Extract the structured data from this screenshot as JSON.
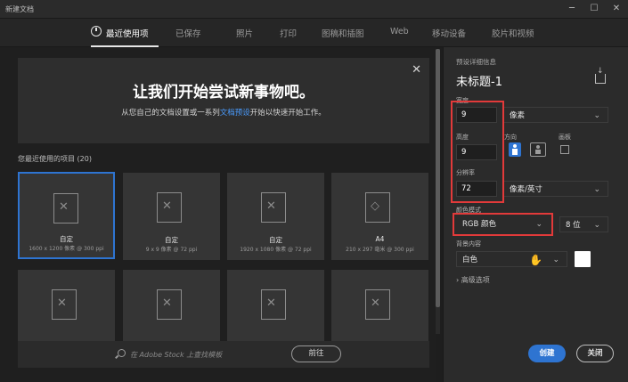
{
  "window": {
    "title": "新建文档",
    "min_icon": "─",
    "max_icon": "☐",
    "close_icon": "✕"
  },
  "tabs": [
    {
      "label": "最近使用项",
      "active": true
    },
    {
      "label": "已保存"
    },
    {
      "label": "照片"
    },
    {
      "label": "打印"
    },
    {
      "label": "图稿和插图"
    },
    {
      "label": "Web"
    },
    {
      "label": "移动设备"
    },
    {
      "label": "胶片和视频"
    }
  ],
  "welcome": {
    "headline": "让我们开始尝试新事物吧。",
    "sub_before": "从您自己的文档设置或一系列",
    "sub_link": "文档预设",
    "sub_after": "开始以快速开始工作。",
    "close_icon": "✕"
  },
  "recent": {
    "label": "您最近使用的项目",
    "count": "(20)",
    "items": [
      {
        "name": "自定",
        "meta": "1600 x 1200 像素 @ 300 ppi",
        "selected": true
      },
      {
        "name": "自定",
        "meta": "9 x 9 像素 @ 72 ppi"
      },
      {
        "name": "自定",
        "meta": "1920 x 1080 像素 @ 72 ppi"
      },
      {
        "name": "A4",
        "meta": "210 x 297 毫米 @ 300 ppi"
      }
    ]
  },
  "stock_search": {
    "placeholder": "在 Adobe Stock 上查找模板",
    "go_label": "前往"
  },
  "preset": {
    "section_label": "预设详细信息",
    "doc_title": "未标题-1",
    "width_label": "宽度",
    "width_value": "9",
    "width_unit": "像素",
    "height_label": "高度",
    "height_value": "9",
    "orientation_label": "方向",
    "artboard_label": "画板",
    "resolution_label": "分辨率",
    "resolution_value": "72",
    "resolution_unit": "像素/英寸",
    "color_mode_label": "颜色模式",
    "color_mode_value": "RGB 颜色",
    "bit_depth_value": "8 位",
    "background_label": "背景内容",
    "background_value": "白色",
    "advanced_label": "高级选项"
  },
  "actions": {
    "create_label": "创建",
    "close_label": "关闭"
  },
  "colors": {
    "accent": "#2e74d1",
    "highlight_box": "#e23a3a",
    "link": "#4a9cff"
  }
}
